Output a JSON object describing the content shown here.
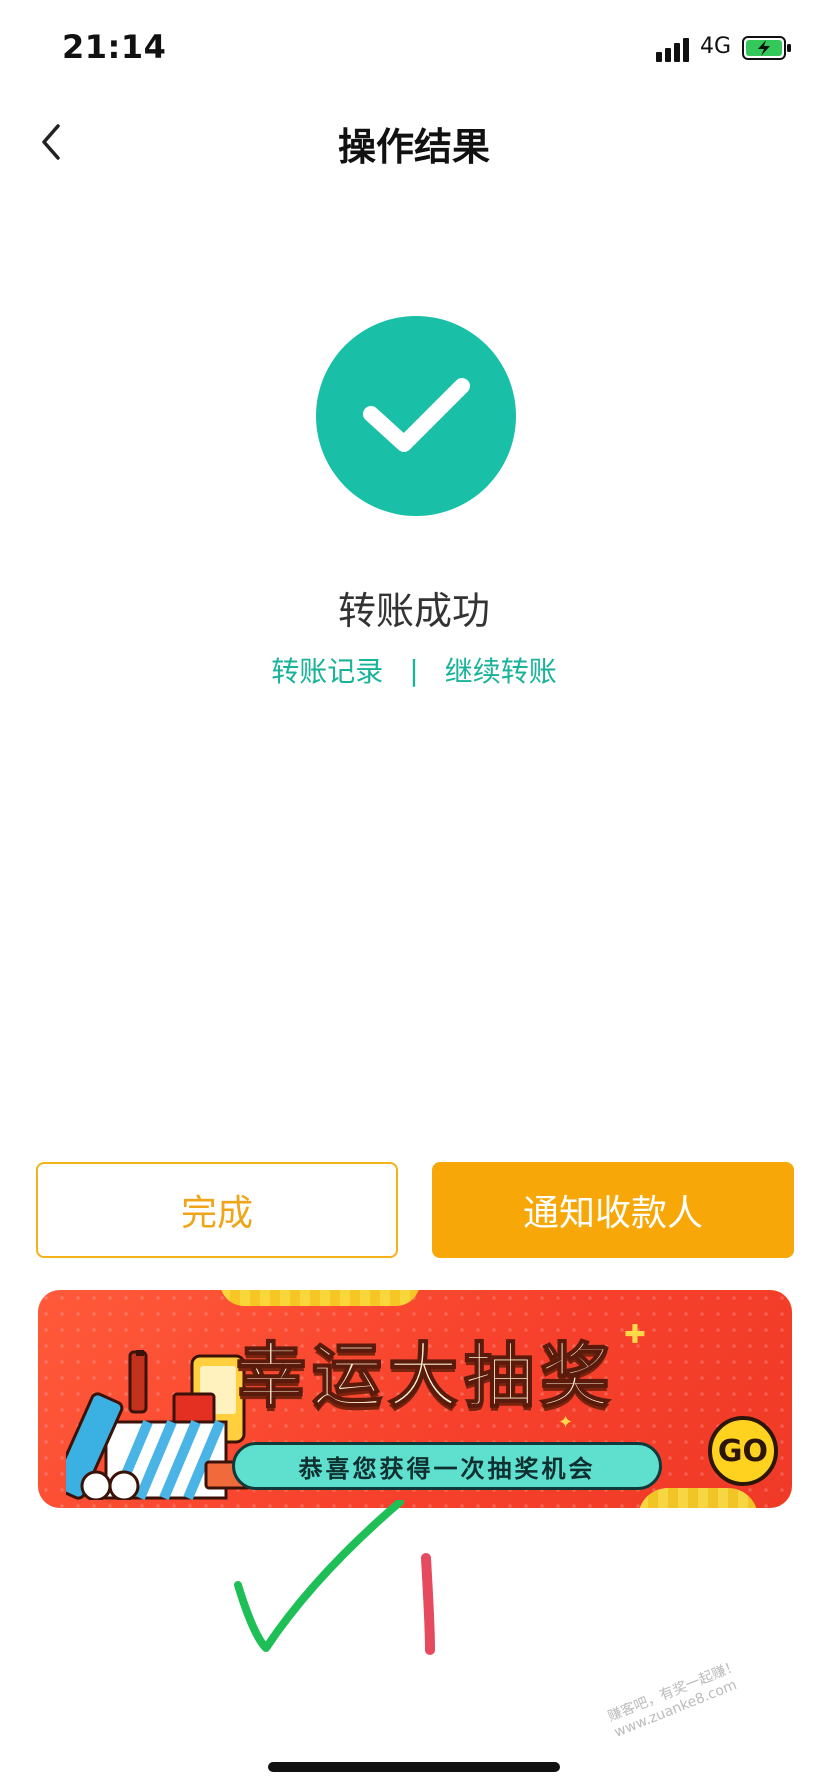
{
  "status_bar": {
    "time": "21:14",
    "network": "4G"
  },
  "nav": {
    "title": "操作结果"
  },
  "result": {
    "message": "转账成功",
    "links": {
      "history": "转账记录",
      "separator": "|",
      "continue": "继续转账"
    }
  },
  "buttons": {
    "done": "完成",
    "notify": "通知收款人"
  },
  "banner": {
    "title": "幸运大抽奖",
    "subtitle": "恭喜您获得一次抽奖机会",
    "go": "GO"
  },
  "watermark": "赚客吧，有奖一起赚！ www.zuanke8.com",
  "colors": {
    "accent_teal": "#19b39a",
    "button_orange": "#f7a808",
    "banner_red": "#f7412c"
  }
}
